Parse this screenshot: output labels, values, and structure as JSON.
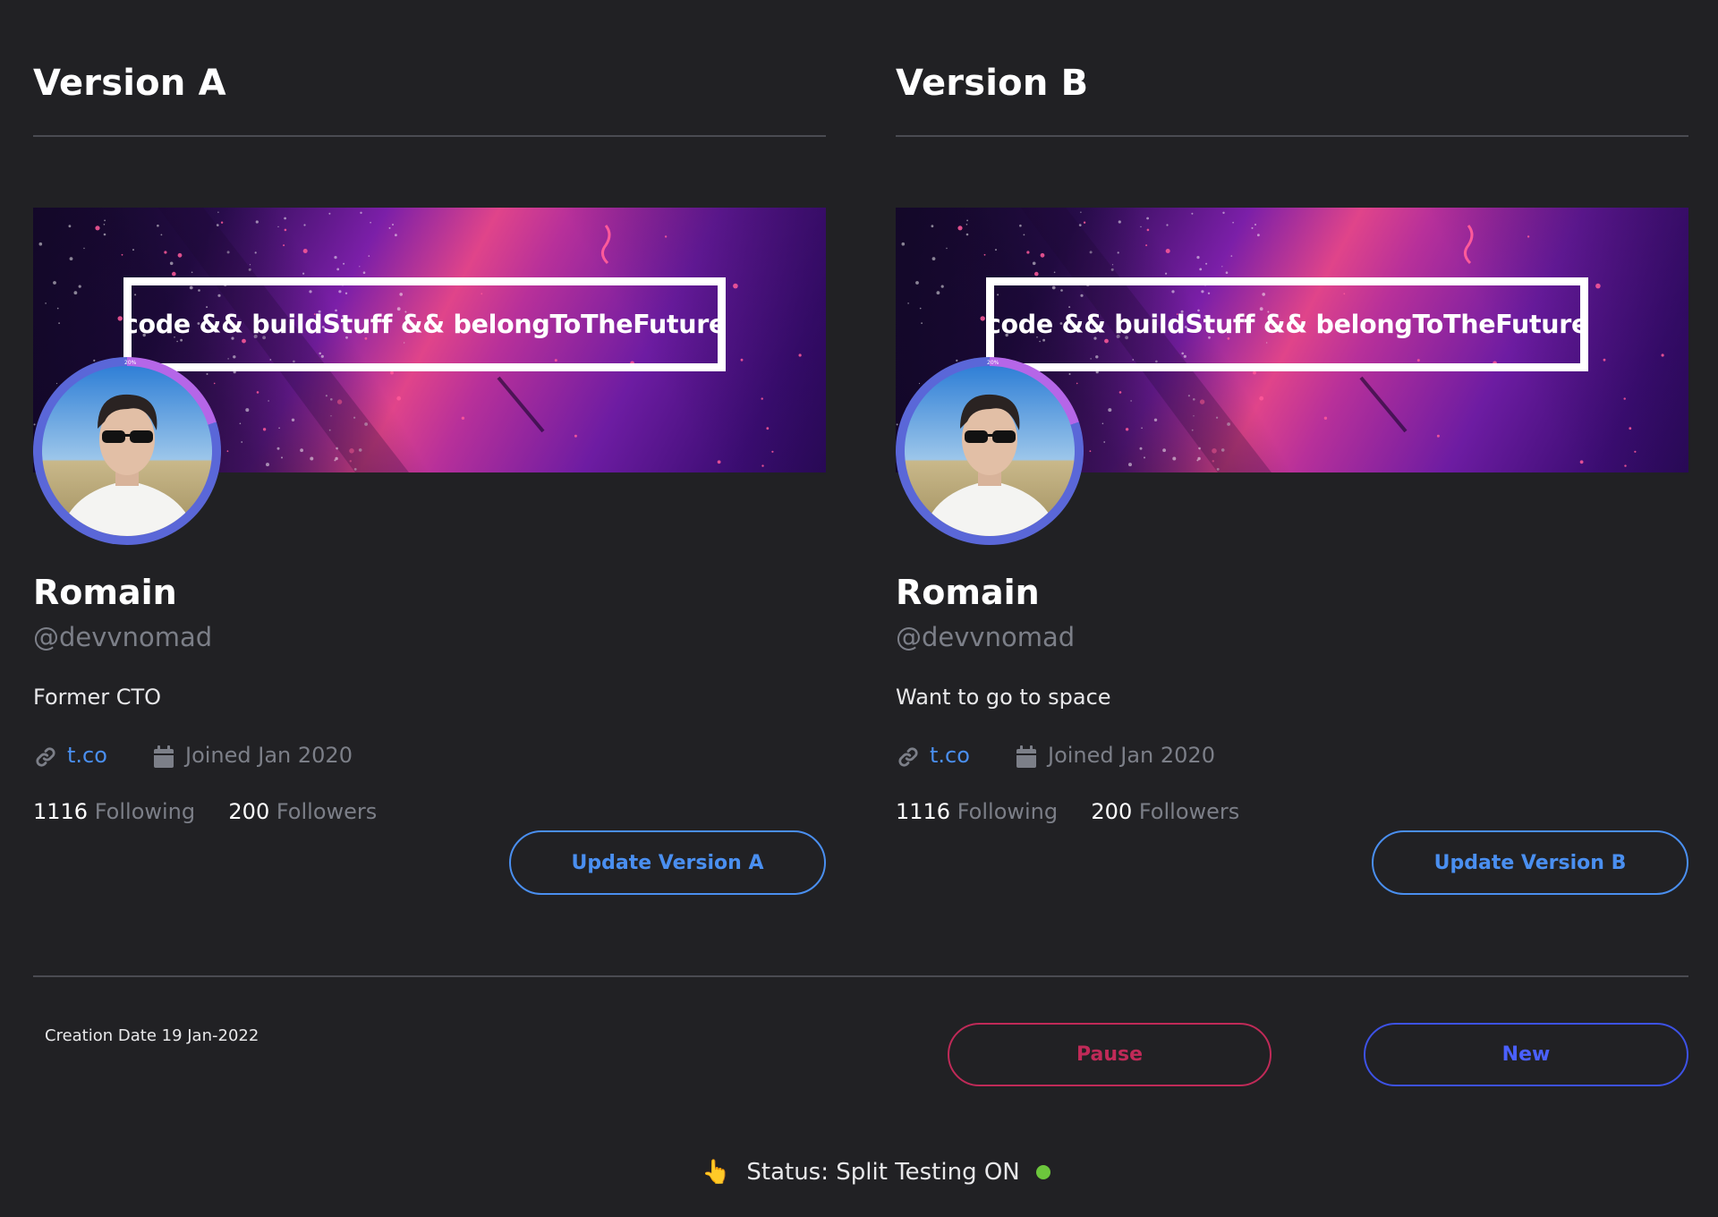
{
  "versions": [
    {
      "title": "Version A",
      "banner_text": "code && buildStuff && belongToTheFuture",
      "avatar_progress_label": "20%",
      "avatar_progress": 0.2,
      "name": "Romain",
      "handle": "@devvnomad",
      "bio": "Former CTO",
      "link_text": "t.co",
      "joined_text": "Joined Jan 2020",
      "following_count": "1116",
      "following_label": "Following",
      "followers_count": "200",
      "followers_label": "Followers",
      "update_label": "Update Version A"
    },
    {
      "title": "Version B",
      "banner_text": "code && buildStuff && belongToTheFuture",
      "avatar_progress_label": "20%",
      "avatar_progress": 0.2,
      "name": "Romain",
      "handle": "@devvnomad",
      "bio": "Want to go to space",
      "link_text": "t.co",
      "joined_text": "Joined Jan 2020",
      "following_count": "1116",
      "following_label": "Following",
      "followers_count": "200",
      "followers_label": "Followers",
      "update_label": "Update Version B"
    }
  ],
  "footer": {
    "creation_date": "Creation Date 19 Jan-2022",
    "pause_label": "Pause",
    "new_label": "New"
  },
  "status": {
    "icon": "pointing-finger-icon",
    "text": "Status: Split Testing ON",
    "indicator_color": "#6cc63c"
  },
  "colors": {
    "background": "#212124",
    "accent_blue": "#4a8ff0",
    "pause_red": "#c02a58",
    "new_blue": "#3d52e6",
    "muted_text": "#7c7f88"
  }
}
